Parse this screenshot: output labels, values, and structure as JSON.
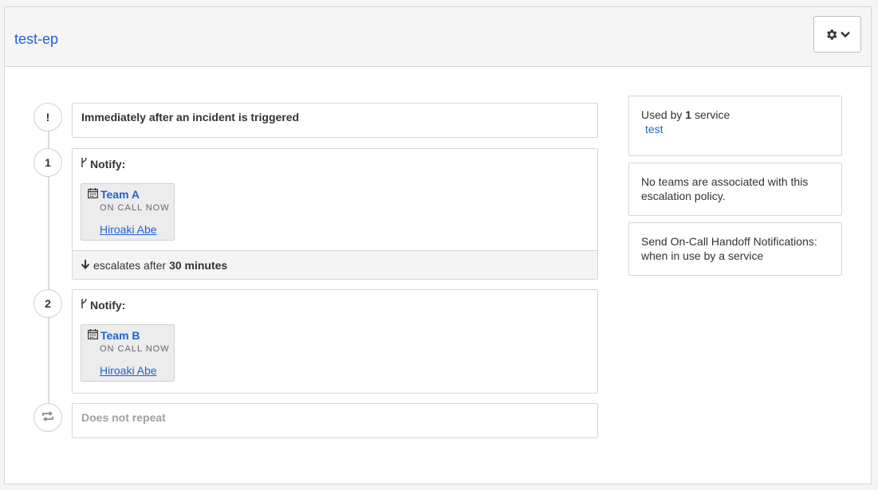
{
  "header": {
    "title": "test-ep",
    "settings_icon": "gear-icon",
    "dropdown_icon": "chevron-down-icon"
  },
  "timeline": {
    "trigger": {
      "marker": "!",
      "text": "Immediately after an incident is triggered"
    },
    "rules": [
      {
        "marker": "1",
        "notify_label": "Notify:",
        "schedule": {
          "name": "Team A",
          "status": "ON CALL NOW",
          "user": "Hiroaki Abe"
        },
        "escalates_prefix": "escalates after",
        "escalates_value": "30 minutes"
      },
      {
        "marker": "2",
        "notify_label": "Notify:",
        "schedule": {
          "name": "Team B",
          "status": "ON CALL NOW",
          "user": "Hiroaki Abe"
        }
      }
    ],
    "repeat": {
      "icon": "repeat-icon",
      "text": "Does not repeat"
    }
  },
  "sidebar": {
    "used_by": {
      "prefix": "Used by",
      "count": "1",
      "suffix": "service",
      "service": "test"
    },
    "teams_text": "No teams are associated with this escalation policy.",
    "handoff_text": "Send On-Call Handoff Notifications: when in use by a service"
  },
  "colors": {
    "link": "#1f62d4",
    "border": "#d6d6d6",
    "header_bg": "#f5f5f5",
    "card_bg": "#ececec",
    "muted": "#a0a0a0"
  }
}
